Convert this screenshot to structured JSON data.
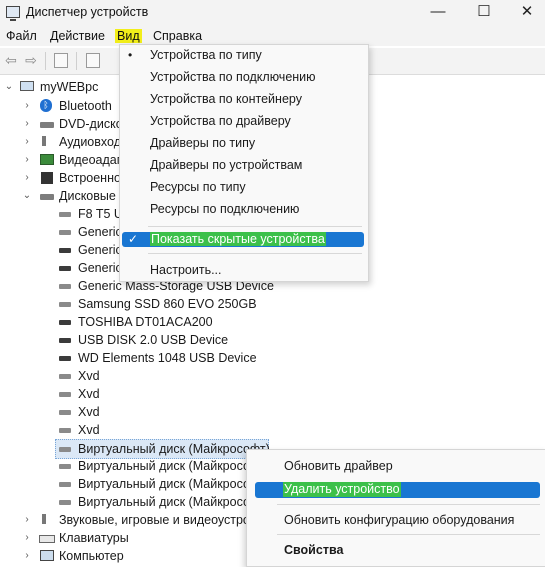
{
  "window": {
    "title": "Диспетчер устройств",
    "minimize_glyph": "—",
    "maximize_glyph": "☐",
    "close_glyph": "✕"
  },
  "menubar": {
    "file": "Файл",
    "action": "Действие",
    "view": "Вид",
    "help": "Справка"
  },
  "toolbar": {
    "back_glyph": "⇦",
    "forward_glyph": "⇨"
  },
  "tree": {
    "root": "myWEBpc",
    "categories": {
      "bluetooth": "Bluetooth",
      "dvd": "DVD-диско",
      "audio_io": "Аудиовход",
      "video": "Видеоадап",
      "builtin": "Встроенно",
      "disks": "Дисковые",
      "sound": "Звуковые, игровые и видеоустрой",
      "keyboards": "Клавиатуры",
      "computer": "Компьютер"
    },
    "disk_items": [
      "F8 T5 U",
      "Generic",
      "Generic",
      "Generic",
      "Generic Mass-Storage USB Device",
      "Samsung SSD 860 EVO 250GB",
      "TOSHIBA DT01ACA200",
      "USB DISK 2.0 USB Device",
      "WD Elements 1048 USB Device",
      "Xvd",
      "Xvd",
      "Xvd",
      "Xvd",
      "Виртуальный диск (Майкрософт)",
      "Виртуальный диск (Майкросо",
      "Виртуальный диск (Майкросо",
      "Виртуальный диск (Майкросо"
    ]
  },
  "view_menu": {
    "items": [
      "Устройства по типу",
      "Устройства по подключению",
      "Устройства по контейнеру",
      "Устройства по драйверу",
      "Драйверы по типу",
      "Драйверы по устройствам",
      "Ресурсы по типу",
      "Ресурсы по подключению"
    ],
    "bullet_glyph": "•",
    "show_hidden": "Показать скрытые устройства",
    "check_glyph": "✓",
    "customize": "Настроить..."
  },
  "context_menu": {
    "update_driver": "Обновить драйвер",
    "uninstall": "Удалить устройство",
    "scan": "Обновить конфигурацию оборудования",
    "properties": "Свойства"
  },
  "colors": {
    "highlight": "#1976d2",
    "green_mark": "#3cc04a",
    "yellow_mark": "#f2ee1a"
  }
}
